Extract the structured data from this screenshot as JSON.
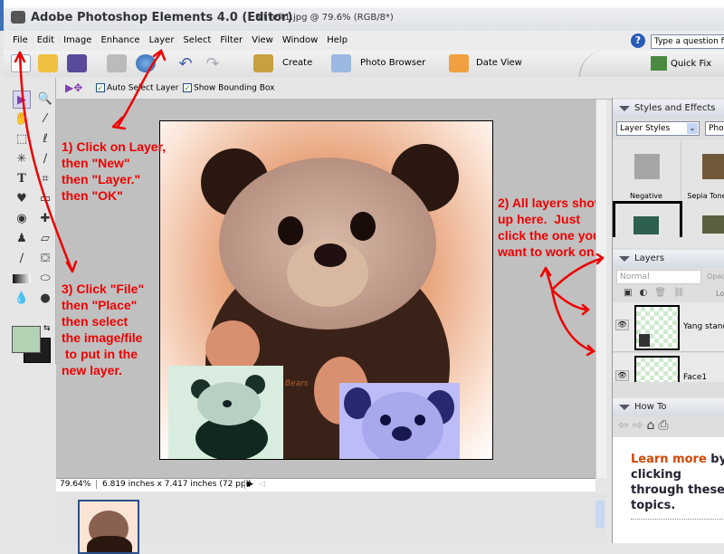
{
  "window": {
    "app_title": "Adobe Photoshop Elements 4.0 (Editor)",
    "file_info": "Sit left1.jpg @ 79.6% (RGB/8*)"
  },
  "menu": [
    "File",
    "Edit",
    "Image",
    "Enhance",
    "Layer",
    "Select",
    "Filter",
    "View",
    "Window",
    "Help"
  ],
  "help": {
    "placeholder": "Type a question for help"
  },
  "toolbar": {
    "create": "Create",
    "photo_browser": "Photo Browser",
    "date_view": "Date View",
    "quick_fix": "Quick Fix"
  },
  "options": {
    "auto_select_layer": "Auto Select Layer",
    "auto_select_checked": true,
    "show_bounding_box": "Show Bounding Box",
    "show_bounding_checked": true
  },
  "colors": {
    "foreground": "#b3d1b3",
    "background": "#1e1e1e",
    "annotation": "#e00000"
  },
  "annotations": {
    "step1": "1) Click on Layer,\nthen \"New\"\nthen \"Layer.\"\nthen \"OK\"",
    "step2": "2) All layers show\nup here.  Just\nclick the one you\nwant to work on.",
    "step3": "3) Click \"File\"\nthen \"Place\"\nthen select\nthe image/file\n to put in the\nnew layer."
  },
  "canvas": {
    "watermark": "Bears"
  },
  "status": {
    "zoom": "79.64%",
    "dimensions": "6.819 inches x 7.417 inches (72 ppi)"
  },
  "styles_panel": {
    "title": "Styles and Effects",
    "category": "Layer Styles",
    "library": "Photo Effects",
    "swatches": [
      {
        "label": "Negative",
        "color": "#a6a6a6"
      },
      {
        "label": "Sepia Tone",
        "color": "#705838"
      },
      {
        "label": "",
        "color": "#2e6050"
      },
      {
        "label": "",
        "color": "#5c6040"
      }
    ]
  },
  "layers_panel": {
    "title": "Layers",
    "blend_mode": "Normal",
    "opacity_label": "Opacity",
    "lock_label": "Lock",
    "layers": [
      {
        "name": "Yang standing"
      },
      {
        "name": "Face1"
      }
    ]
  },
  "howto_panel": {
    "title": "How To",
    "learn_more": "Learn more",
    "text_rest": " by clicking through these topics."
  }
}
